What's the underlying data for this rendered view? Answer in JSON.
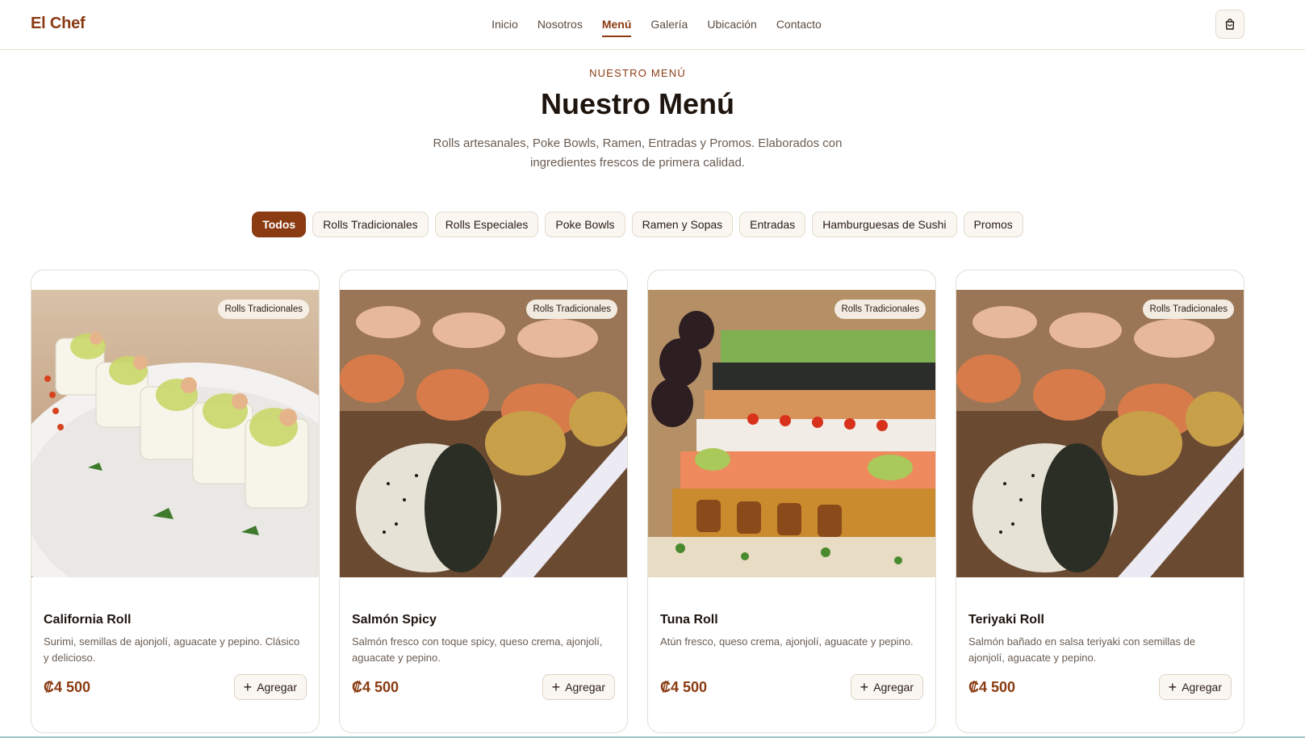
{
  "header": {
    "brand": "El Chef",
    "nav": [
      "Inicio",
      "Nosotros",
      "Menú",
      "Galería",
      "Ubicación",
      "Contacto"
    ],
    "active_nav": "Menú",
    "cart_icon": "shopping-bag-icon"
  },
  "hero": {
    "eyebrow": "NUESTRO MENÚ",
    "title": "Nuestro Menú",
    "subtitle": "Rolls artesanales, Poke Bowls, Ramen, Entradas y Promos. Elaborados con ingredientes frescos de primera calidad."
  },
  "filters": [
    "Todos",
    "Rolls Tradicionales",
    "Rolls Especiales",
    "Poke Bowls",
    "Ramen y Sopas",
    "Entradas",
    "Hamburguesas de Sushi",
    "Promos"
  ],
  "active_filter": "Todos",
  "products": [
    {
      "category": "Rolls Tradicionales",
      "name": "California Roll",
      "description": "Surimi, semillas de ajonjolí, aguacate y pepino. Clásico y delicioso.",
      "price": "₡4 500",
      "button": "Agregar"
    },
    {
      "category": "Rolls Tradicionales",
      "name": "Salmón Spicy",
      "description": "Salmón fresco con toque spicy, queso crema, ajonjolí, aguacate y pepino.",
      "price": "₡4 500",
      "button": "Agregar"
    },
    {
      "category": "Rolls Tradicionales",
      "name": "Tuna Roll",
      "description": "Atún fresco, queso crema, ajonjolí, aguacate y pepino.",
      "price": "₡4 500",
      "button": "Agregar"
    },
    {
      "category": "Rolls Tradicionales",
      "name": "Teriyaki Roll",
      "description": "Salmón bañado en salsa teriyaki con semillas de ajonjolí, aguacate y pepino.",
      "price": "₡4 500",
      "button": "Agregar"
    }
  ],
  "colors": {
    "accent": "#8a3b12",
    "chip_bg": "#faf7f2"
  }
}
